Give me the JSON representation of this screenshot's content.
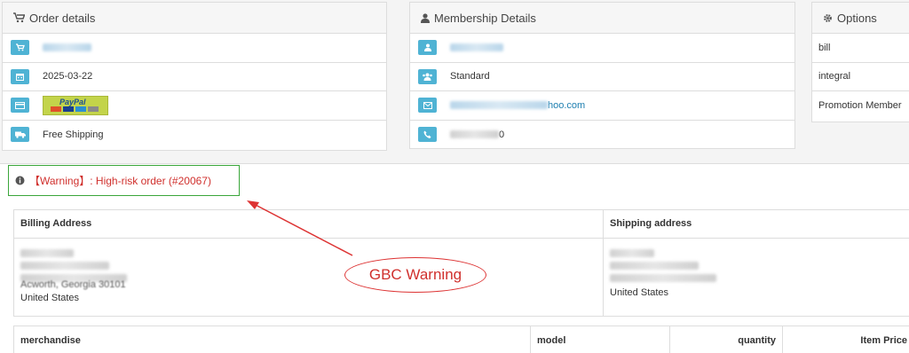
{
  "order": {
    "title": "Order details",
    "date": "2025-03-22",
    "payment_label": "PayPal",
    "shipping": "Free Shipping"
  },
  "membership": {
    "title": "Membership Details",
    "level": "Standard",
    "email_suffix": "hoo.com",
    "phone_suffix": "0"
  },
  "options": {
    "title": "Options",
    "items": [
      "bill",
      "integral",
      "Promotion Member"
    ]
  },
  "warning": {
    "text": "【Warning】: High-risk order (#20067)"
  },
  "addresses": {
    "billing_header": "Billing Address",
    "shipping_header": "Shipping address",
    "billing_city": "Acworth, Georgia 30101",
    "billing_country": "United States",
    "shipping_country": "United States"
  },
  "items_table": {
    "headers": [
      "merchandise",
      "model",
      "quantity",
      "Item Price"
    ]
  },
  "annotation": {
    "label": "GBC Warning"
  },
  "colors": {
    "icon_box": "#4fb3d4",
    "warning_text": "#d0302d",
    "warning_border": "#3aa63a",
    "link": "#1e7fb0"
  }
}
